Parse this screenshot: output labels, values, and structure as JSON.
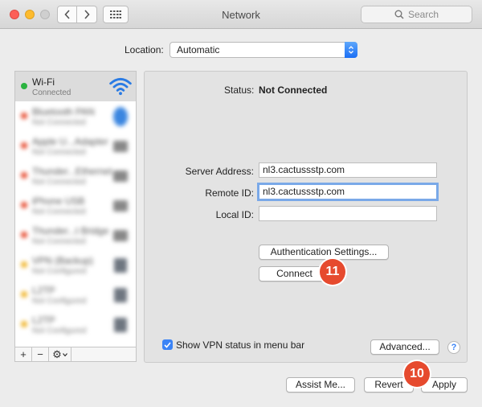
{
  "window": {
    "title": "Network"
  },
  "search": {
    "placeholder": "Search"
  },
  "location": {
    "label": "Location:",
    "value": "Automatic"
  },
  "sidebar": {
    "services": [
      {
        "name": "Wi-Fi",
        "status": "Connected",
        "dot": "#2bb340"
      },
      {
        "name": "Bluetooth PAN",
        "status": "Not Connected",
        "dot": "#e64a2e"
      },
      {
        "name": "Apple U...Adapter",
        "status": "Not Connected",
        "dot": "#e64a2e"
      },
      {
        "name": "Thunder...Ethernet",
        "status": "Not Connected",
        "dot": "#e64a2e"
      },
      {
        "name": "iPhone USB",
        "status": "Not Connected",
        "dot": "#e64a2e"
      },
      {
        "name": "Thunder...t Bridge",
        "status": "Not Connected",
        "dot": "#e64a2e"
      },
      {
        "name": "VPN (Backup)",
        "status": "Not Configured",
        "dot": "#f0b429"
      },
      {
        "name": "L2TP",
        "status": "Not Configured",
        "dot": "#f0b429"
      },
      {
        "name": "L2TP",
        "status": "Not Configured",
        "dot": "#f0b429"
      }
    ],
    "toolbar": {
      "add": "+",
      "remove": "−",
      "action": "⚙"
    }
  },
  "details": {
    "status_label": "Status:",
    "status_value": "Not Connected",
    "server_label": "Server Address:",
    "server_value": "nl3.cactussstp.com",
    "remote_label": "Remote ID:",
    "remote_value": "nl3.cactussstp.com",
    "local_label": "Local ID:",
    "local_value": "",
    "auth_button": "Authentication Settings...",
    "connect_button": "Connect",
    "step_connect": "11",
    "show_vpn_label": "Show VPN status in menu bar",
    "advanced_button": "Advanced...",
    "help": "?"
  },
  "footer": {
    "assist_button": "Assist Me...",
    "revert_button": "Revert",
    "apply_button": "Apply",
    "step_apply": "10"
  }
}
